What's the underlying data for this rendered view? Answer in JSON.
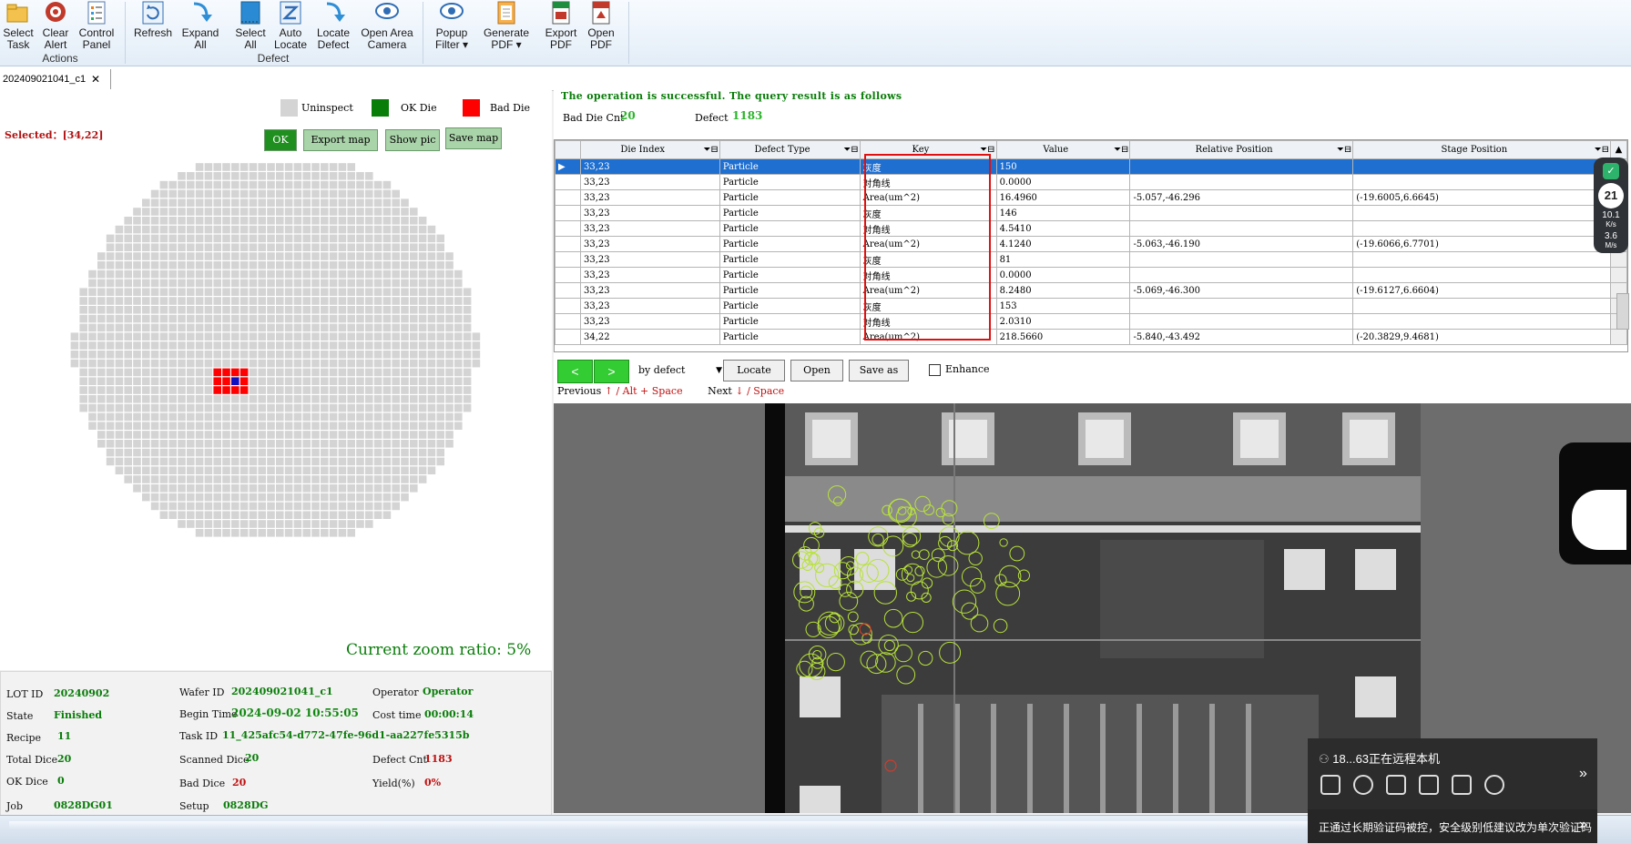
{
  "ribbon": {
    "buttons": [
      {
        "key": "select_task",
        "l1": "Select",
        "l2": "Task"
      },
      {
        "key": "clear_alert",
        "l1": "Clear",
        "l2": "Alert"
      },
      {
        "key": "control_panel",
        "l1": "Control",
        "l2": "Panel"
      },
      {
        "key": "refresh",
        "l1": "Refresh",
        "l2": ""
      },
      {
        "key": "expand_all",
        "l1": "Expand",
        "l2": "All"
      },
      {
        "key": "select_all",
        "l1": "Select",
        "l2": "All"
      },
      {
        "key": "auto_locate",
        "l1": "Auto",
        "l2": "Locate"
      },
      {
        "key": "locate_defect",
        "l1": "Locate",
        "l2": "Defect"
      },
      {
        "key": "open_area_camera",
        "l1": "Open Area",
        "l2": "Camera"
      },
      {
        "key": "popup_filter",
        "l1": "Popup",
        "l2": "Filter ▾"
      },
      {
        "key": "generate_pdf",
        "l1": "Generate",
        "l2": "PDF ▾"
      },
      {
        "key": "export_pdf",
        "l1": "Export",
        "l2": "PDF"
      },
      {
        "key": "open_pdf",
        "l1": "Open",
        "l2": "PDF"
      }
    ],
    "groups": {
      "actions": "Actions",
      "defect": "Defect"
    }
  },
  "tab": {
    "label": "202409021041_c1",
    "close": "✕"
  },
  "legend": {
    "uninspect": "Uninspect",
    "ok": "OK Die",
    "bad": "Bad Die"
  },
  "colors": {
    "uninspect": "#d4d4d4",
    "ok": "#087d08",
    "bad": "#ff0000",
    "selected_die": "#1010c0",
    "selected_row": "#1f6fd1"
  },
  "selected": "Selected：[34,22]",
  "map_buttons": {
    "ok": "OK",
    "export": "Export map",
    "show": "Show pic",
    "save": "Save map"
  },
  "zoom": "Current zoom ratio: 5%",
  "info": {
    "lot_id_l": "LOT ID",
    "lot_id": "20240902",
    "wafer_id_l": "Wafer ID",
    "wafer_id": "202409021041_c1",
    "operator_l": "Operator",
    "operator": "Operator",
    "state_l": "State",
    "state": "Finished",
    "begin_l": "Begin Time",
    "begin": "2024-09-02 10:55:05",
    "cost_l": "Cost time",
    "cost": "00:00:14",
    "recipe_l": "Recipe",
    "recipe": "11",
    "task_l": "Task ID",
    "task": "11_425afc54-d772-47fe-96d1-aa227fe5315b",
    "total_l": "Total Dice",
    "total": "20",
    "scanned_l": "Scanned Dice",
    "scanned": "20",
    "defect_l": "Defect Cnt",
    "defect": "1183",
    "okd_l": "OK Dice",
    "okd": "0",
    "bad_l": "Bad Dice",
    "bad": "20",
    "yield_l": "Yield(%)",
    "yield": "0%",
    "job_l": "Job",
    "job": "0828DG01",
    "setup_l": "Setup",
    "setup": "0828DG"
  },
  "result": {
    "message": "The operation is successful. The query result is as follows",
    "bad_die_l": "Bad Die Cnt",
    "bad_die": "20",
    "defect_l": "Defect",
    "defect": "1183"
  },
  "table": {
    "headers": [
      "Die Index",
      "Defect Type",
      "Key",
      "Value",
      "Relative Position",
      "Stage Position"
    ],
    "rows": [
      [
        "33,23",
        "Particle",
        "灰度",
        "150",
        "",
        ""
      ],
      [
        "33,23",
        "Particle",
        "对角线",
        "0.0000",
        "",
        ""
      ],
      [
        "33,23",
        "Particle",
        "Area(um^2)",
        "16.4960",
        "-5.057,-46.296",
        "(-19.6005,6.6645)"
      ],
      [
        "33,23",
        "Particle",
        "灰度",
        "146",
        "",
        ""
      ],
      [
        "33,23",
        "Particle",
        "对角线",
        "4.5410",
        "",
        ""
      ],
      [
        "33,23",
        "Particle",
        "Area(um^2)",
        "4.1240",
        "-5.063,-46.190",
        "(-19.6066,6.7701)"
      ],
      [
        "33,23",
        "Particle",
        "灰度",
        "81",
        "",
        ""
      ],
      [
        "33,23",
        "Particle",
        "对角线",
        "0.0000",
        "",
        ""
      ],
      [
        "33,23",
        "Particle",
        "Area(um^2)",
        "8.2480",
        "-5.069,-46.300",
        "(-19.6127,6.6604)"
      ],
      [
        "33,23",
        "Particle",
        "灰度",
        "153",
        "",
        ""
      ],
      [
        "33,23",
        "Particle",
        "对角线",
        "2.0310",
        "",
        ""
      ],
      [
        "34,22",
        "Particle",
        "Area(um^2)",
        "218.5660",
        "-5.840,-43.492",
        "(-20.3829,9.4681)"
      ]
    ]
  },
  "nav": {
    "prev": "<",
    "next": ">",
    "mode": "by defect",
    "locate": "Locate",
    "open": "Open",
    "save_as": "Save as",
    "enhance": "Enhance",
    "prev_label": "Previous",
    "prev_key": "↑ / Alt + Space",
    "next_label": "Next",
    "next_key": "↓ / Space"
  },
  "widget": {
    "pct": "21",
    "up": "10.1",
    "up_unit": "K/s",
    "down": "3.6",
    "down_unit": "M/s"
  },
  "remote": {
    "title": "18...63正在远程本机",
    "warning": "正通过长期验证码被控，安全级别低建议改为单次验证码"
  }
}
